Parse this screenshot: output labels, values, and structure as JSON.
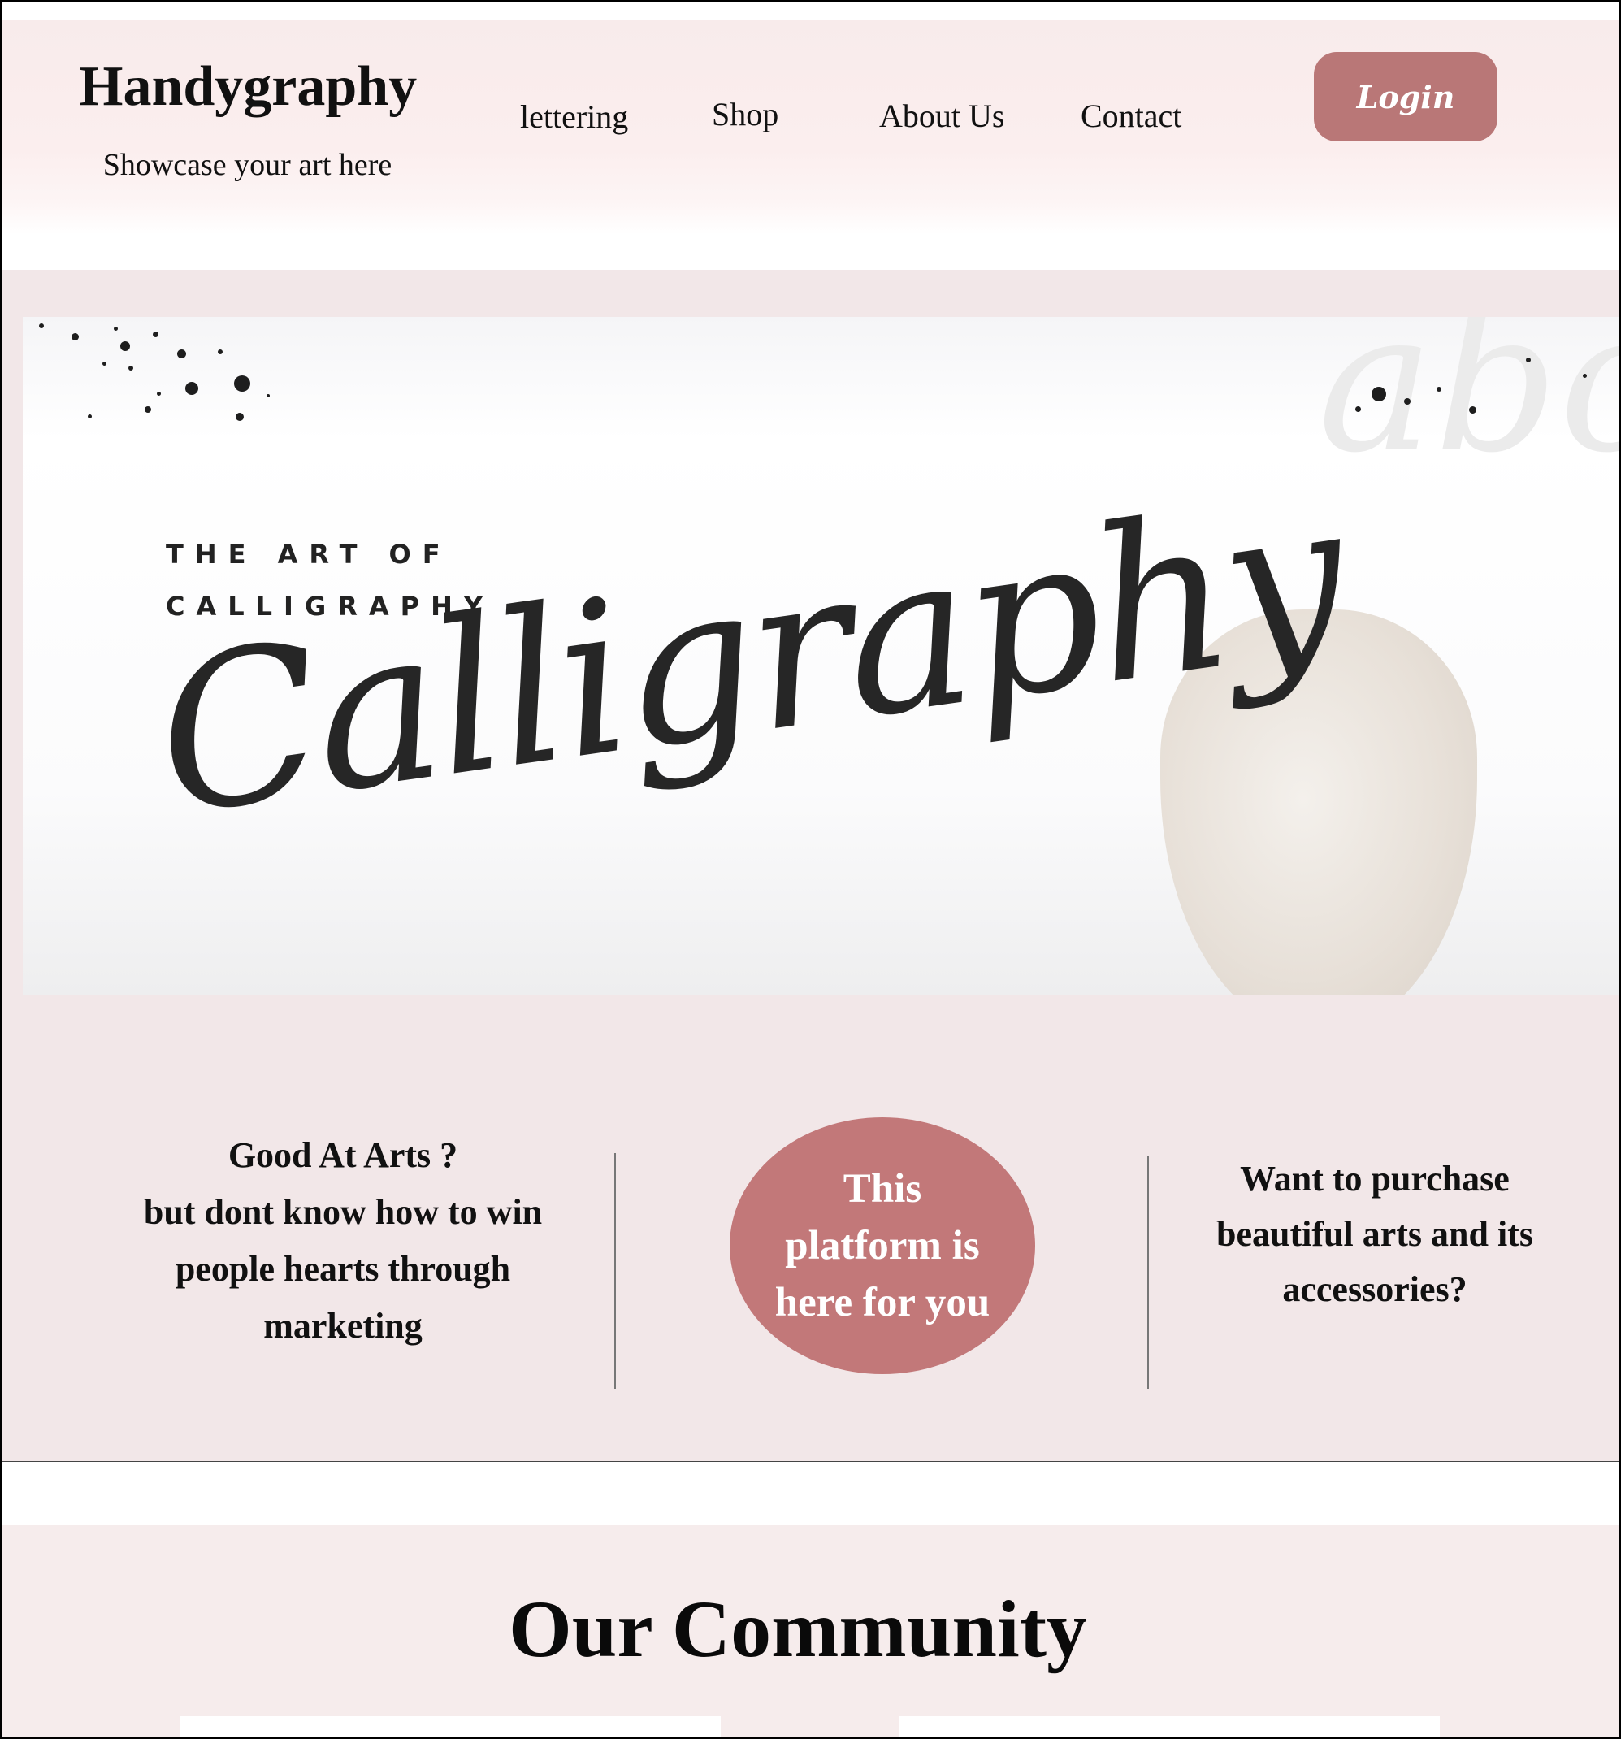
{
  "brand": {
    "title": "Handygraphy",
    "tagline": "Showcase your art here"
  },
  "nav": {
    "items": [
      "lettering",
      "Shop",
      "About Us",
      "Contact"
    ],
    "login_label": "Login"
  },
  "hero": {
    "subtitle_line1": "THE ART OF",
    "subtitle_line2": "CALLIGRAPHY",
    "script_word": "Calligraphy",
    "background_letters": "abc"
  },
  "info": {
    "left_lines": [
      "Good At Arts ?",
      "but dont know how to win",
      "people hearts through",
      "marketing"
    ],
    "cta_text": "This platform is here for you",
    "right_text": "Want to purchase beautiful arts and its accessories?"
  },
  "community": {
    "title": "Our Community"
  },
  "colors": {
    "accent": "#c27879",
    "login_bg": "#b97777",
    "header_bg": "#f8ebeb",
    "section_bg": "#f2e7e8",
    "community_bg": "#f6ecec"
  }
}
